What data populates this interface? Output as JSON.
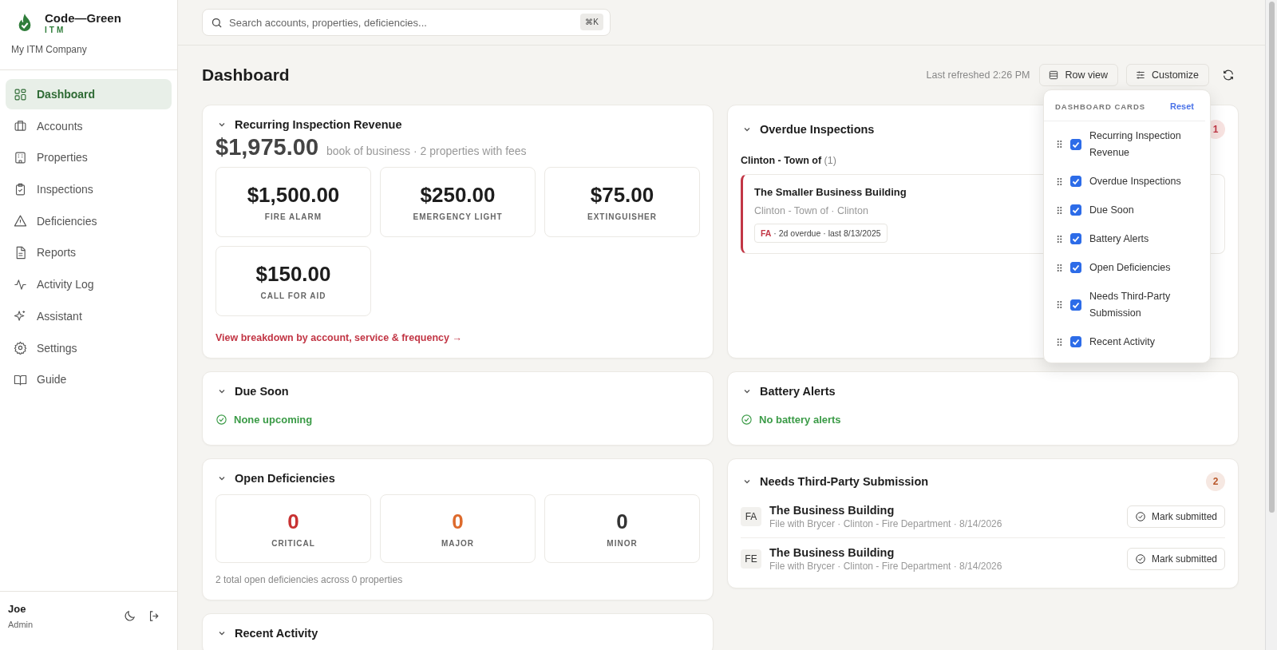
{
  "sidebar": {
    "brand": "Code—Green",
    "brand_sub": "ITM",
    "company": "My ITM Company",
    "items": [
      {
        "label": "Dashboard",
        "selected": true
      },
      {
        "label": "Accounts",
        "selected": false
      },
      {
        "label": "Properties",
        "selected": false
      },
      {
        "label": "Inspections",
        "selected": false
      },
      {
        "label": "Deficiencies",
        "selected": false
      },
      {
        "label": "Reports",
        "selected": false
      },
      {
        "label": "Activity Log",
        "selected": false
      },
      {
        "label": "Assistant",
        "selected": false
      },
      {
        "label": "Settings",
        "selected": false
      },
      {
        "label": "Guide",
        "selected": false
      }
    ],
    "user": {
      "name": "Joe",
      "role": "Admin"
    }
  },
  "search": {
    "placeholder": "Search accounts, properties, deficiencies...",
    "shortcut": "⌘K"
  },
  "header": {
    "title": "Dashboard",
    "refreshed": "Last refreshed 2:26 PM",
    "buttons": [
      "Row view",
      "Customize"
    ]
  },
  "customize_menu": {
    "title": "DASHBOARD CARDS",
    "reset": "Reset",
    "items": [
      {
        "label": "Recurring Inspection Revenue",
        "checked": true
      },
      {
        "label": "Overdue Inspections",
        "checked": true
      },
      {
        "label": "Due Soon",
        "checked": true
      },
      {
        "label": "Battery Alerts",
        "checked": true
      },
      {
        "label": "Open Deficiencies",
        "checked": true
      },
      {
        "label": "Needs Third-Party Submission",
        "checked": true
      },
      {
        "label": "Recent Activity",
        "checked": true
      }
    ]
  },
  "revenue": {
    "title": "Recurring Inspection Revenue",
    "total": "$1,975.00",
    "note": "book of business · 2 properties with fees",
    "tiles": [
      {
        "amount": "$1,500.00",
        "label": "FIRE ALARM"
      },
      {
        "amount": "$250.00",
        "label": "EMERGENCY LIGHT"
      },
      {
        "amount": "$75.00",
        "label": "EXTINGUISHER"
      },
      {
        "amount": "$150.00",
        "label": "CALL FOR AID"
      }
    ],
    "link": "View breakdown by account, service & frequency →"
  },
  "overdue": {
    "title": "Overdue Inspections",
    "count": "1",
    "group": {
      "name": "Clinton - Town of",
      "count": "(1)"
    },
    "items": [
      {
        "title": "The Smaller Business Building",
        "subtitle": "Clinton - Town of · Clinton",
        "tag": "FA",
        "detail": " · 2d overdue · last 8/13/2025"
      }
    ]
  },
  "due_soon": {
    "title": "Due Soon",
    "status": "None upcoming"
  },
  "battery": {
    "title": "Battery Alerts",
    "status": "No battery alerts"
  },
  "deficiencies": {
    "title": "Open Deficiencies",
    "tiles": [
      {
        "count": "0",
        "label": "CRITICAL",
        "color": "#c83232"
      },
      {
        "count": "0",
        "label": "MAJOR",
        "color": "#dd6a2c"
      },
      {
        "count": "0",
        "label": "MINOR",
        "color": "#333333"
      }
    ],
    "footer": "2 total open deficiencies across 0 properties"
  },
  "third_party": {
    "title": "Needs Third-Party Submission",
    "count": "2",
    "rows": [
      {
        "code": "FA",
        "title": "The Business Building",
        "detail": "File with Brycer · Clinton - Fire Department · 8/14/2026",
        "action": "Mark submitted"
      },
      {
        "code": "FE",
        "title": "The Business Building",
        "detail": "File with Brycer · Clinton - Fire Department · 8/14/2026",
        "action": "Mark submitted"
      }
    ]
  },
  "recent": {
    "title": "Recent Activity"
  }
}
